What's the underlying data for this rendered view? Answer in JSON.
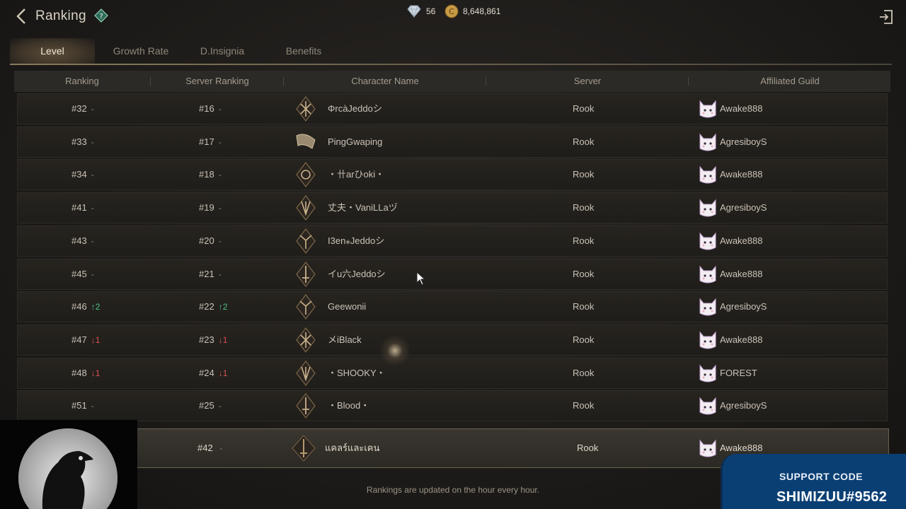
{
  "header": {
    "title": "Ranking",
    "gems": "56",
    "gold": "8,648,861"
  },
  "tabs": [
    {
      "label": "Level",
      "active": true
    },
    {
      "label": "Growth Rate",
      "active": false
    },
    {
      "label": "D.Insignia",
      "active": false
    },
    {
      "label": "Benefits",
      "active": false
    }
  ],
  "columns": {
    "ranking": "Ranking",
    "server_ranking": "Server Ranking",
    "character_name": "Character Name",
    "server": "Server",
    "guild": "Affiliated Guild"
  },
  "rows": [
    {
      "rank": "#32",
      "rank_change": "-",
      "rank_dir": "none",
      "srank": "#16",
      "srank_change": "-",
      "srank_dir": "none",
      "name": "ΦrcàJeddoシ",
      "server": "Rook",
      "guild": "Awake888"
    },
    {
      "rank": "#33",
      "rank_change": "-",
      "rank_dir": "none",
      "srank": "#17",
      "srank_change": "-",
      "srank_dir": "none",
      "name": "PingGwaping",
      "server": "Rook",
      "guild": "AgresiboyS"
    },
    {
      "rank": "#34",
      "rank_change": "-",
      "rank_dir": "none",
      "srank": "#18",
      "srank_change": "-",
      "srank_dir": "none",
      "name": "・卄arひoki・",
      "server": "Rook",
      "guild": "Awake888"
    },
    {
      "rank": "#41",
      "rank_change": "-",
      "rank_dir": "none",
      "srank": "#19",
      "srank_change": "-",
      "srank_dir": "none",
      "name": "丈夫・VaniLLaヅ",
      "server": "Rook",
      "guild": "AgresiboyS"
    },
    {
      "rank": "#43",
      "rank_change": "-",
      "rank_dir": "none",
      "srank": "#20",
      "srank_change": "-",
      "srank_dir": "none",
      "name": "I3en⁎Jeddoシ",
      "server": "Rook",
      "guild": "Awake888"
    },
    {
      "rank": "#45",
      "rank_change": "-",
      "rank_dir": "none",
      "srank": "#21",
      "srank_change": "-",
      "srank_dir": "none",
      "name": "イu六Jeddoシ",
      "server": "Rook",
      "guild": "Awake888"
    },
    {
      "rank": "#46",
      "rank_change": "↑2",
      "rank_dir": "up",
      "srank": "#22",
      "srank_change": "↑2",
      "srank_dir": "up",
      "name": "Geewonii",
      "server": "Rook",
      "guild": "AgresiboyS"
    },
    {
      "rank": "#47",
      "rank_change": "↓1",
      "rank_dir": "down",
      "srank": "#23",
      "srank_change": "↓1",
      "srank_dir": "down",
      "name": "メiBlack",
      "server": "Rook",
      "guild": "Awake888"
    },
    {
      "rank": "#48",
      "rank_change": "↓1",
      "rank_dir": "down",
      "srank": "#24",
      "srank_change": "↓1",
      "srank_dir": "down",
      "name": "・SHOOKY・",
      "server": "Rook",
      "guild": "FOREST"
    },
    {
      "rank": "#51",
      "rank_change": "-",
      "rank_dir": "none",
      "srank": "#25",
      "srank_change": "-",
      "srank_dir": "none",
      "name": "・Blood・",
      "server": "Rook",
      "guild": "AgresiboyS"
    }
  ],
  "my_row": {
    "srank": "#42",
    "srank_change": "-",
    "name": "แคลร์และเคน",
    "server": "Rook",
    "guild": "Awake888"
  },
  "footer": {
    "note": "Rankings are updated on the hour every hour."
  },
  "overlay": {
    "support_label": "SUPPORT CODE",
    "support_code": "SHIMIZUU#9562"
  },
  "colors": {
    "up": "#4ec08a",
    "down": "#d9534f",
    "support_bg": "#0a3f74"
  }
}
